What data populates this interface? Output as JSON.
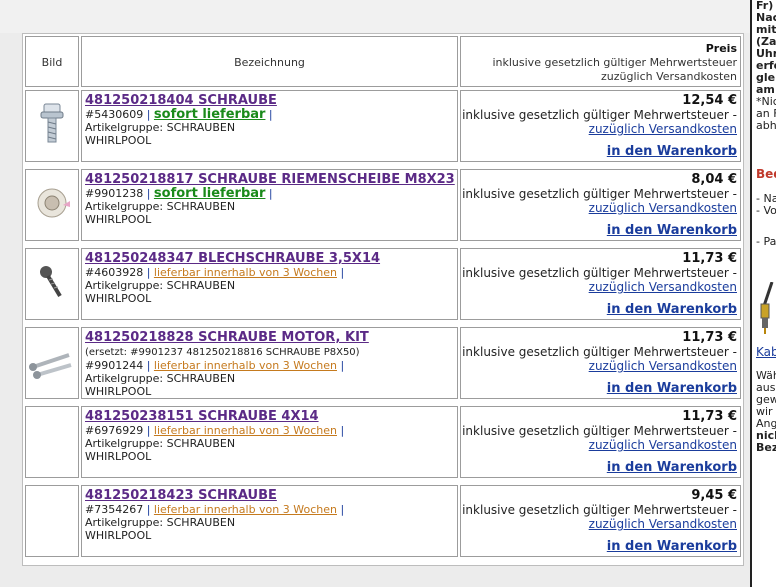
{
  "header": {
    "bild": "Bild",
    "bezeichnung": "Bezeichnung",
    "preis": "Preis",
    "preis_line1": "inklusive gesetzlich gültiger Mehrwertsteuer",
    "preis_line2": "zuzüglich Versandkosten"
  },
  "rows": [
    {
      "title": "481250218404 SCHRAUBE",
      "replaced": "",
      "code": "#5430609",
      "availability": "sofort lieferbar",
      "availability_type": "green",
      "group": "Artikelgruppe: SCHRAUBEN",
      "brand": "WHIRLPOOL",
      "price": "12,54 €",
      "vat": "inklusive gesetzlich gültiger Mehrwertsteuer -",
      "shipping": "zuzüglich Versandkosten",
      "cart": "in den Warenkorb",
      "image": "screw-icon"
    },
    {
      "title": "481250218817 SCHRAUBE RIEMENSCHEIBE M8X23",
      "replaced": "",
      "code": "#9901238",
      "availability": "sofort lieferbar",
      "availability_type": "green",
      "group": "Artikelgruppe: SCHRAUBEN",
      "brand": "WHIRLPOOL",
      "price": "8,04 €",
      "vat": "inklusive gesetzlich gültiger Mehrwertsteuer -",
      "shipping": "zuzüglich Versandkosten",
      "cart": "in den Warenkorb",
      "image": "washer-screw-icon"
    },
    {
      "title": "481250248347 BLECHSCHRAUBE 3,5X14",
      "replaced": "",
      "code": "#4603928",
      "availability": "lieferbar innerhalb von 3 Wochen",
      "availability_type": "orange",
      "group": "Artikelgruppe: SCHRAUBEN",
      "brand": "WHIRLPOOL",
      "price": "11,73 €",
      "vat": "inklusive gesetzlich gültiger Mehrwertsteuer -",
      "shipping": "zuzüglich Versandkosten",
      "cart": "in den Warenkorb",
      "image": "sheet-metal-screw-icon"
    },
    {
      "title": "481250218828 SCHRAUBE MOTOR, KIT",
      "replaced": "(ersetzt: #9901237 481250218816 SCHRAUBE P8X50)",
      "code": "#9901244",
      "availability": "lieferbar innerhalb von 3 Wochen",
      "availability_type": "orange",
      "group": "Artikelgruppe: SCHRAUBEN",
      "brand": "WHIRLPOOL",
      "price": "11,73 €",
      "vat": "inklusive gesetzlich gültiger Mehrwertsteuer -",
      "shipping": "zuzüglich Versandkosten",
      "cart": "in den Warenkorb",
      "image": "screw-kit-icon"
    },
    {
      "title": "481250238151 SCHRAUBE 4X14",
      "replaced": "",
      "code": "#6976929",
      "availability": "lieferbar innerhalb von 3 Wochen",
      "availability_type": "orange",
      "group": "Artikelgruppe: SCHRAUBEN",
      "brand": "WHIRLPOOL",
      "price": "11,73 €",
      "vat": "inklusive gesetzlich gültiger Mehrwertsteuer -",
      "shipping": "zuzüglich Versandkosten",
      "cart": "in den Warenkorb",
      "image": ""
    },
    {
      "title": "481250218423 SCHRAUBE",
      "replaced": "",
      "code": "#7354267",
      "availability": "lieferbar innerhalb von 3 Wochen",
      "availability_type": "orange",
      "group": "Artikelgruppe: SCHRAUBEN",
      "brand": "WHIRLPOOL",
      "price": "9,45 €",
      "vat": "inklusive gesetzlich gültiger Mehrwertsteuer -",
      "shipping": "zuzüglich Versandkosten",
      "cart": "in den Warenkorb",
      "image": ""
    }
  ],
  "right_column": {
    "lines": [
      "Fr)",
      "Nac",
      "mit",
      "(Za",
      "Uhr",
      "erfo",
      "gle",
      "am",
      "*Nic",
      "an F",
      "abh"
    ],
    "bed": "Bed",
    "list": [
      "- Na",
      "- Vo",
      "- Pa"
    ],
    "kab": "Kab",
    "text": [
      "Wäh",
      "aus",
      "gew",
      "wir",
      "Ang",
      "nich",
      "Bez"
    ]
  },
  "colors": {
    "title": "#5b2a86",
    "available": "#1a8a1a",
    "delayed": "#c57a1e",
    "link": "#1a3c9c"
  }
}
